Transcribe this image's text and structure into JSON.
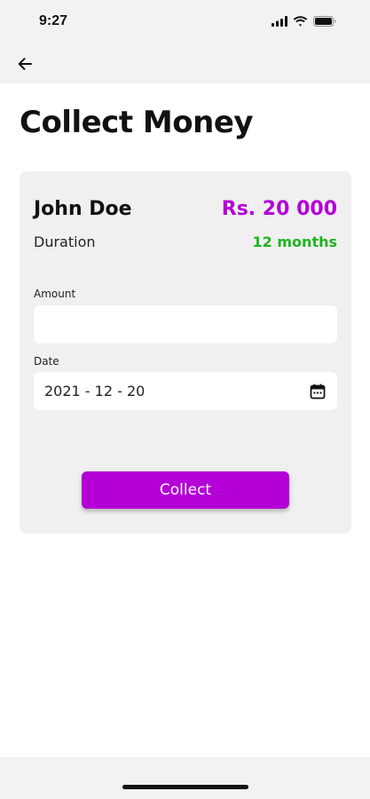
{
  "status_bar": {
    "time": "9:27",
    "icons": [
      "cellular-signal-icon",
      "wifi-icon",
      "battery-icon"
    ]
  },
  "app_bar": {
    "back_icon": "arrow-left-icon"
  },
  "page": {
    "title": "Collect Money"
  },
  "card": {
    "name": "John Doe",
    "amount": "Rs. 20 000",
    "duration_label": "Duration",
    "duration_value": "12 months",
    "amount_field": {
      "label": "Amount",
      "value": "",
      "placeholder": ""
    },
    "date_field": {
      "label": "Date",
      "value": "2021 - 12 - 20",
      "icon": "calendar-icon"
    },
    "collect_label": "Collect"
  },
  "colors": {
    "accent": "#b400d6",
    "success": "#1eb41e",
    "card_bg": "#f0f0f0",
    "bar_bg": "#f2f2f2"
  }
}
